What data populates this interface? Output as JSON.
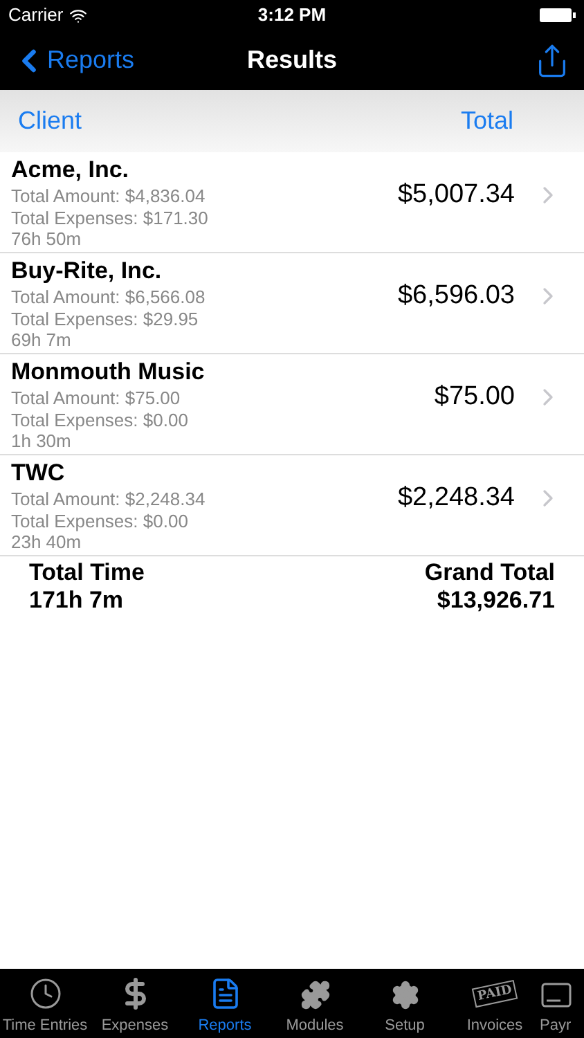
{
  "status_bar": {
    "carrier": "Carrier",
    "time": "3:12 PM"
  },
  "nav": {
    "back": "Reports",
    "title": "Results"
  },
  "header": {
    "left": "Client",
    "right": "Total"
  },
  "rows": [
    {
      "client": "Acme, Inc.",
      "amount": "Total Amount: $4,836.04",
      "expenses": "Total Expenses: $171.30",
      "time": "76h 50m",
      "total": "$5,007.34"
    },
    {
      "client": "Buy-Rite, Inc.",
      "amount": "Total Amount: $6,566.08",
      "expenses": "Total Expenses: $29.95",
      "time": "69h 7m",
      "total": "$6,596.03"
    },
    {
      "client": "Monmouth Music",
      "amount": "Total Amount: $75.00",
      "expenses": "Total Expenses: $0.00",
      "time": "1h 30m",
      "total": "$75.00"
    },
    {
      "client": "TWC",
      "amount": "Total Amount: $2,248.34",
      "expenses": "Total Expenses: $0.00",
      "time": "23h 40m",
      "total": "$2,248.34"
    }
  ],
  "summary": {
    "time_label": "Total Time",
    "time": "171h 7m",
    "total_label": "Grand Total",
    "total": "$13,926.71"
  },
  "tabs": [
    {
      "label": "Time Entries",
      "kind": "clock",
      "selected": false
    },
    {
      "label": "Expenses",
      "kind": "dollar",
      "selected": false
    },
    {
      "label": "Reports",
      "kind": "document",
      "selected": true
    },
    {
      "label": "Modules",
      "kind": "puzzle",
      "selected": false
    },
    {
      "label": "Setup",
      "kind": "gear",
      "selected": false
    },
    {
      "label": "Invoices",
      "kind": "stamp",
      "stamp": "PAID",
      "selected": false
    },
    {
      "label": "Payr",
      "kind": "card",
      "selected": false
    }
  ]
}
